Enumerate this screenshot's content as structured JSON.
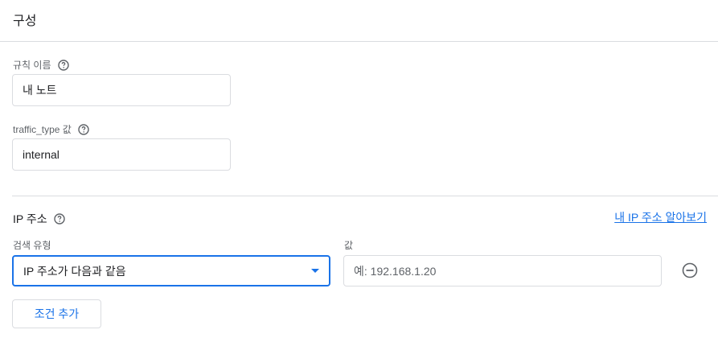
{
  "section": {
    "title": "구성"
  },
  "rule_name": {
    "label": "규칙 이름",
    "value": "내 노트"
  },
  "traffic_type": {
    "label": "traffic_type 값",
    "value": "internal"
  },
  "ip_address": {
    "heading": "IP 주소",
    "link": "내 IP 주소 알아보기",
    "match_type_label": "검색 유형",
    "match_type_value": "IP 주소가 다음과 같음",
    "value_label": "값",
    "value_placeholder": "예: 192.168.1.20",
    "value_input": ""
  },
  "actions": {
    "add_condition": "조건 추가"
  },
  "icons": {
    "help": "help-circle-icon",
    "remove": "remove-circle-icon",
    "dropdown": "caret-down-icon"
  },
  "colors": {
    "accent": "#1a73e8",
    "border": "#dadce0",
    "secondary_text": "#5f6368"
  }
}
